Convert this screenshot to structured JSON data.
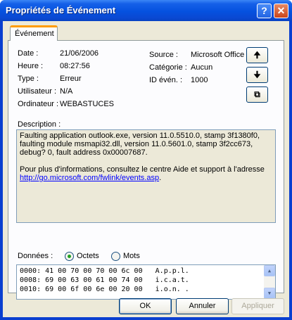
{
  "window": {
    "title": "Propriétés de Événement",
    "help_glyph": "?",
    "close_glyph": "✕"
  },
  "tab": {
    "label": "Événement"
  },
  "event": {
    "date_label": "Date :",
    "date_value": "21/06/2006",
    "time_label": "Heure :",
    "time_value": "08:27:56",
    "type_label": "Type :",
    "type_value": "Erreur",
    "user_label": "Utilisateur :",
    "user_value": "N/A",
    "computer_label": "Ordinateur :",
    "computer_value": "WEBASTUCES",
    "source_label": "Source :",
    "source_value": "Microsoft Office",
    "category_label": "Catégorie :",
    "category_value": "Aucun",
    "id_label": "ID évén. :",
    "id_value": "1000"
  },
  "side_buttons": {
    "up_glyph": "🠉",
    "down_glyph": "🠋",
    "copy_glyph": "⧉"
  },
  "description": {
    "label": "Description :",
    "para1": "Faulting application outlook.exe, version 11.0.5510.0, stamp 3f1380f0, faulting module msmapi32.dll, version 11.0.5601.0, stamp 3f2cc673, debug? 0, fault address 0x00007687.",
    "para2": "Pour plus d'informations, consultez le centre Aide et support à l'adresse",
    "link": "http://go.microsoft.com/fwlink/events.asp",
    "link_suffix": "."
  },
  "data_section": {
    "label": "Données :",
    "option_bytes": "Octets",
    "option_words": "Mots",
    "selected": "Octets",
    "rows": [
      "0000: 41 00 70 00 70 00 6c 00   A.p.p.l.",
      "0008: 69 00 63 00 61 00 74 00   i.c.a.t.",
      "0010: 69 00 6f 00 6e 00 20 00   i.o.n. ."
    ]
  },
  "buttons": {
    "ok": "OK",
    "cancel": "Annuler",
    "apply": "Appliquer"
  }
}
